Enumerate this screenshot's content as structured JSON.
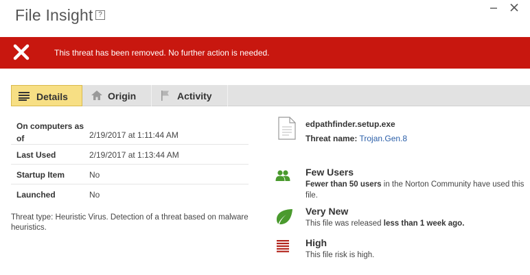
{
  "window": {
    "title": "File Insight",
    "help": "?",
    "minimize": "—",
    "close": "✕"
  },
  "banner": {
    "message": "This threat has been removed. No further action is needed.",
    "color": "#c8170f"
  },
  "tabs": [
    {
      "label": "Details",
      "icon": "list-icon",
      "selected": true
    },
    {
      "label": "Origin",
      "icon": "home-icon",
      "selected": false
    },
    {
      "label": "Activity",
      "icon": "flag-icon",
      "selected": false
    }
  ],
  "details": {
    "rows": [
      {
        "label": "On computers as of",
        "value": "2/19/2017 at 1:11:44 AM"
      },
      {
        "label": "Last Used",
        "value": "2/19/2017 at 1:13:44 AM"
      },
      {
        "label": "Startup Item",
        "value": "No"
      },
      {
        "label": "Launched",
        "value": "No"
      }
    ],
    "threat_type": "Threat type: Heuristic Virus. Detection of a threat based on malware heuristics."
  },
  "file": {
    "name": "edpathfinder.setup.exe",
    "threat_name_label": "Threat name:",
    "threat_name": "Trojan.Gen.8"
  },
  "insights": [
    {
      "icon": "users-icon",
      "title": "Few Users",
      "desc_bold": "Fewer than 50 users",
      "desc_rest": " in the Norton Community have used this file."
    },
    {
      "icon": "leaf-icon",
      "title": "Very New",
      "desc_pre": "This file was released ",
      "desc_bold": "less than 1 week ago."
    },
    {
      "icon": "risk-bars-icon",
      "title": "High",
      "desc": "This file risk is high."
    }
  ],
  "colors": {
    "accent_red": "#c8170f",
    "tab_selected": "#f7df84",
    "link": "#2a5ea8",
    "green": "#4a9a2e",
    "risk_red": "#b3241c"
  }
}
